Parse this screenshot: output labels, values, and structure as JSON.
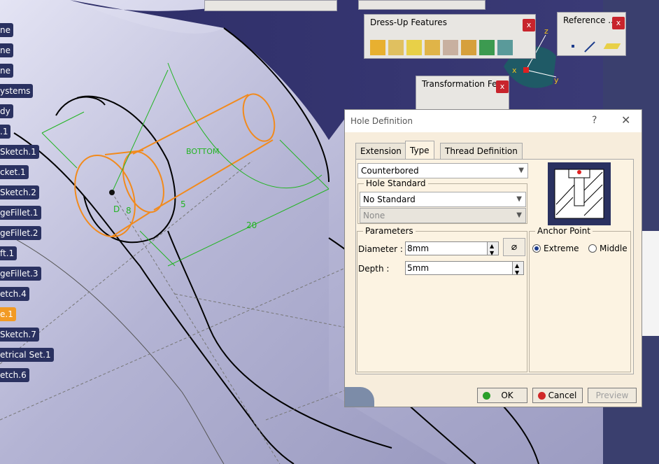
{
  "tree": {
    "items": [
      {
        "label": "ne"
      },
      {
        "label": "ne"
      },
      {
        "label": "ne"
      },
      {
        "label": "ystems"
      },
      {
        "label": "dy"
      },
      {
        "label": ".1"
      },
      {
        "label": "Sketch.1"
      },
      {
        "label": "cket.1"
      },
      {
        "label": "Sketch.2"
      },
      {
        "label": "geFillet.1"
      },
      {
        "label": "geFillet.2"
      },
      {
        "label": "ft.1"
      },
      {
        "label": "geFillet.3"
      },
      {
        "label": "etch.4"
      },
      {
        "label": "e.1"
      },
      {
        "label": "Sketch.7"
      },
      {
        "label": "etrical Set.1"
      },
      {
        "label": "etch.6"
      }
    ],
    "active_label": "e.1"
  },
  "toolbars": {
    "dressup": {
      "title": "Dress-Up Features",
      "close": "x"
    },
    "reference": {
      "title": "Reference ...",
      "close": "x"
    },
    "transformation": {
      "title": "Transformation Fe...",
      "close": "x"
    }
  },
  "viewport": {
    "dim_20": "20",
    "dim_8": "8",
    "dim_d": "D",
    "dim_5": "5",
    "bottom_label": "BOTTOM",
    "axis_x": "x",
    "axis_y": "y",
    "axis_z": "z"
  },
  "dialog": {
    "title": "Hole Definition",
    "help": "?",
    "close": "✕",
    "tabs": [
      {
        "label": "Extension"
      },
      {
        "label": "Type"
      },
      {
        "label": "Thread Definition"
      }
    ],
    "active_tab": "Type",
    "hole_type": "Counterbored",
    "hole_standard_label": "Hole Standard",
    "standard_value": "No Standard",
    "standard_sub": "None",
    "parameters_label": "Parameters",
    "diameter_label": "Diameter :",
    "diameter_value": "8mm",
    "depth_label": "Depth :",
    "depth_value": "5mm",
    "anchor_label": "Anchor Point",
    "anchor_extreme": "Extreme",
    "anchor_middle": "Middle",
    "anchor_selected": "Extreme",
    "ok": "OK",
    "cancel": "Cancel",
    "preview": "Preview"
  },
  "colors": {
    "viewport_bg": "#b8b8dc",
    "tree_bg": "#2a3160",
    "tree_active": "#f29a24",
    "sketch_orange": "#f28a1c",
    "constraint_green": "#22b422",
    "dialog_bg": "#f7eddc"
  }
}
